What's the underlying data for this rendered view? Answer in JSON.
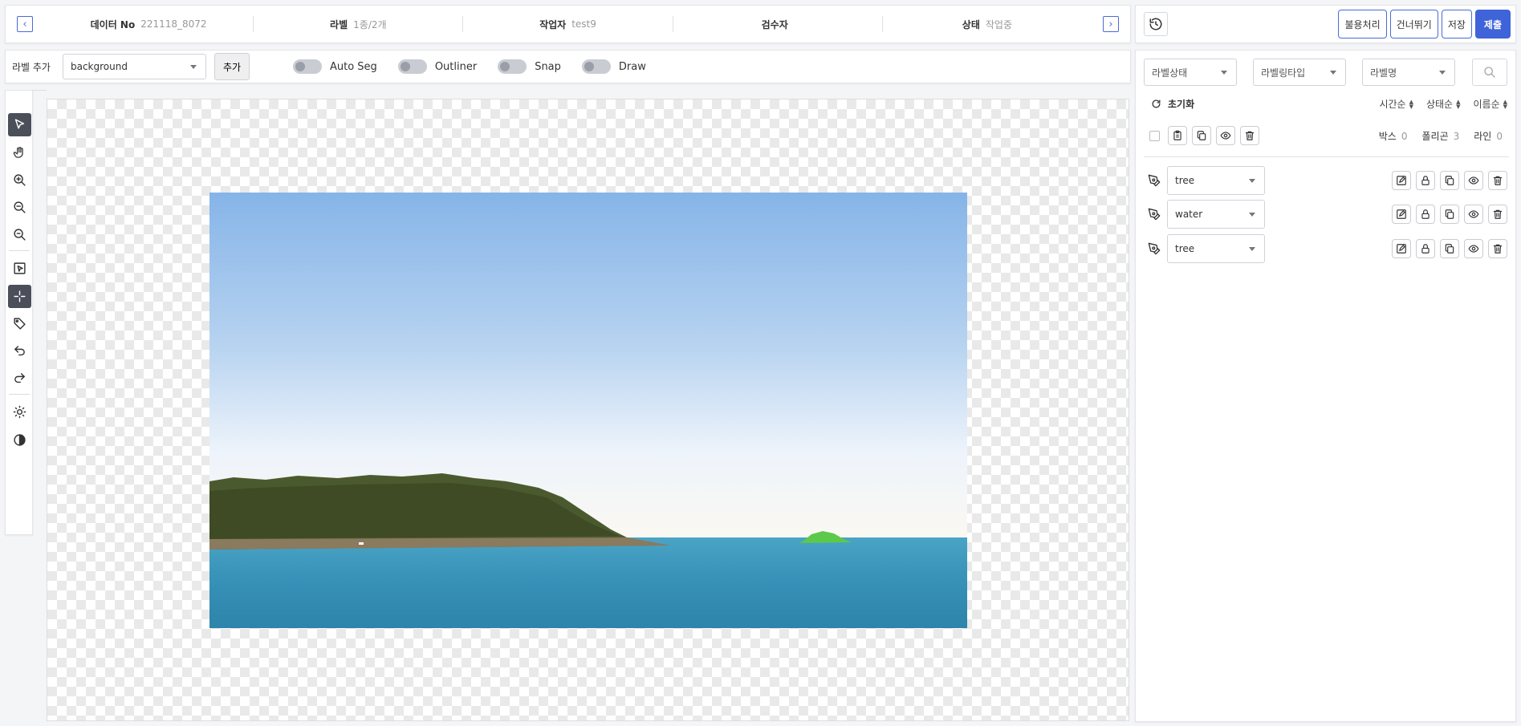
{
  "header": {
    "prev_icon": "chevron-left-icon",
    "next_icon": "chevron-right-icon",
    "fields": [
      {
        "key": "데이터 No",
        "value": "221118_8072"
      },
      {
        "key": "라벨",
        "value": "1종/2개"
      },
      {
        "key": "작업자",
        "value": "test9"
      },
      {
        "key": "검수자",
        "value": ""
      },
      {
        "key": "상태",
        "value": "작업중"
      }
    ]
  },
  "actions": {
    "history_icon": "history-icon",
    "reject": "불용처리",
    "skip": "건너뛰기",
    "save": "저장",
    "submit": "제출"
  },
  "labelbar": {
    "label": "라벨 추가",
    "selected_label": "background",
    "add": "추가",
    "toggles": [
      "Auto Seg",
      "Outliner",
      "Snap",
      "Draw"
    ]
  },
  "tools": [
    "pointer-icon",
    "hand-icon",
    "zoom-in-icon",
    "zoom-out-icon",
    "zoom-reset-icon",
    "select-box-icon",
    "crosshair-icon",
    "tag-icon",
    "undo-icon",
    "redo-icon",
    "brightness-icon",
    "contrast-icon"
  ],
  "list": {
    "filters": [
      "라벨상태",
      "라벨링타입",
      "라벨명"
    ],
    "reset": "초기화",
    "sorts": [
      "시간순",
      "상태순",
      "이름순"
    ],
    "counts": [
      {
        "name": "박스",
        "value": "0"
      },
      {
        "name": "폴리곤",
        "value": "3"
      },
      {
        "name": "라인",
        "value": "0"
      }
    ],
    "items": [
      {
        "label": "tree"
      },
      {
        "label": "water"
      },
      {
        "label": "tree"
      }
    ]
  },
  "colors": {
    "accent": "#3f63d8",
    "selection_green": "#5cc94a"
  }
}
